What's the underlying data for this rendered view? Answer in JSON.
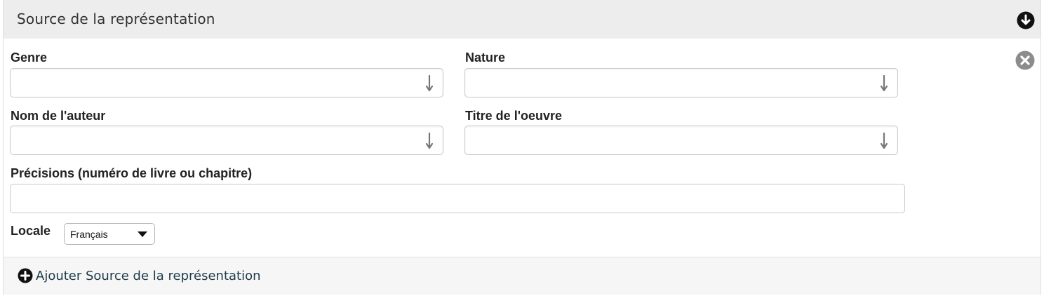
{
  "section": {
    "title": "Source de la représentation",
    "collapse_icon": "chevron-down-circle-icon",
    "remove_icon": "close-circle-icon"
  },
  "fields": {
    "genre": {
      "label": "Genre",
      "value": ""
    },
    "nature": {
      "label": "Nature",
      "value": ""
    },
    "auteur": {
      "label": "Nom de l'auteur",
      "value": ""
    },
    "titre": {
      "label": "Titre de l'oeuvre",
      "value": ""
    },
    "precisions": {
      "label": "Précisions (numéro de livre ou chapitre)",
      "value": ""
    }
  },
  "locale": {
    "label": "Locale",
    "selected": "Français"
  },
  "footer": {
    "add_label": "Ajouter Source de la représentation",
    "add_icon": "plus-circle-icon"
  },
  "colors": {
    "header_bg": "#ededed",
    "link": "#1d3b4a"
  }
}
